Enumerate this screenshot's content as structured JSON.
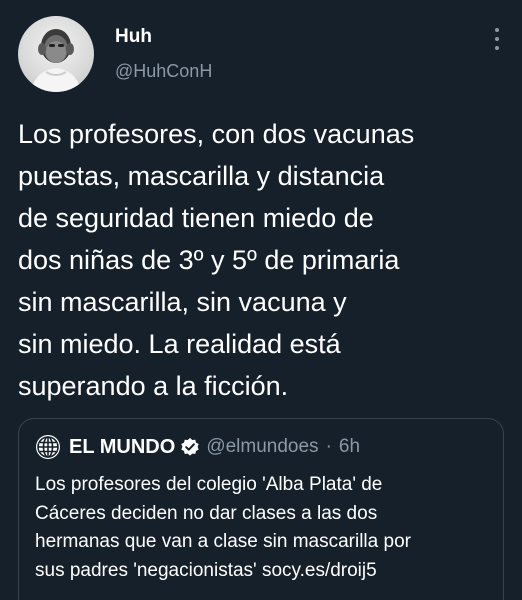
{
  "author": {
    "display_name": "Huh",
    "handle": "@HuhConH",
    "avatar_icon": "profile-photo-avatar"
  },
  "more_icon": "ellipsis-vertical-icon",
  "tweet": {
    "lines": [
      "Los profesores, con dos vacunas",
      "puestas, mascarilla y distancia",
      "de seguridad tienen miedo de",
      "dos niñas de 3º y 5º de primaria",
      "sin mascarilla, sin vacuna y",
      "sin miedo. La realidad está",
      "superando a la ficción."
    ]
  },
  "quoted_tweet": {
    "avatar_icon": "globe-icon",
    "display_name": "EL MUNDO",
    "verified_icon": "verified-badge-icon",
    "handle": "@elmundoes",
    "separator": "·",
    "time": "6h",
    "lines": [
      "Los profesores del colegio 'Alba Plata' de",
      "Cáceres deciden no dar clases a las dos",
      "hermanas que van a clase sin mascarilla por",
      "sus padres 'negacionistas' socy.es/droij5"
    ]
  },
  "colors": {
    "background": "#15202b",
    "primary_text": "#ffffff",
    "secondary_text": "#8b98a5",
    "border": "#38444d",
    "verified_blue": "#1d9bf0"
  }
}
